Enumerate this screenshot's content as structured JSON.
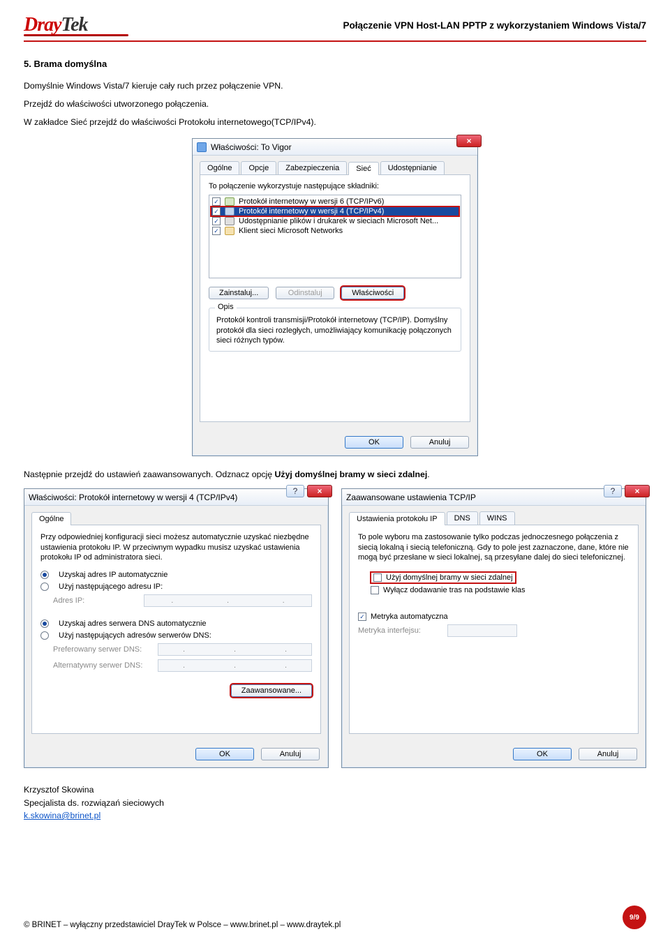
{
  "header": {
    "logo_main": "Dray",
    "logo_tail": "Tek",
    "doc_title": "Połączenie VPN Host-LAN PPTP z wykorzystaniem Windows Vista/7"
  },
  "section": {
    "heading": "5. Brama domyślna",
    "p1": "Domyślnie Windows Vista/7 kieruje cały ruch przez połączenie VPN.",
    "p2": "Przejdź do właściwości utworzonego połączenia.",
    "p3": "W zakładce Sieć przejdź do właściwości Protokołu internetowego(TCP/IPv4).",
    "p4_a": "Następnie przejdź do ustawień zaawansowanych. Odznacz opcję ",
    "p4_b": "Użyj domyślnej bramy w sieci zdalnej",
    "p4_c": "."
  },
  "dialog1": {
    "title": "Właściwości: To Vigor",
    "tabs": [
      "Ogólne",
      "Opcje",
      "Zabezpieczenia",
      "Sieć",
      "Udostępnianie"
    ],
    "active_tab": 3,
    "list_caption": "To połączenie wykorzystuje następujące składniki:",
    "items": [
      "Protokół internetowy w wersji 6 (TCP/IPv6)",
      "Protokół internetowy w wersji 4 (TCP/IPv4)",
      "Udostępnianie plików i drukarek w sieciach Microsoft Net...",
      "Klient sieci Microsoft Networks"
    ],
    "btn_install": "Zainstaluj...",
    "btn_uninstall": "Odinstaluj",
    "btn_props": "Właściwości",
    "desc_legend": "Opis",
    "desc_text": "Protokół kontroli transmisji/Protokół internetowy (TCP/IP). Domyślny protokół dla sieci rozległych, umożliwiający komunikację połączonych sieci różnych typów.",
    "ok": "OK",
    "cancel": "Anuluj"
  },
  "dialog2": {
    "title": "Właściwości: Protokół internetowy w wersji 4 (TCP/IPv4)",
    "tab": "Ogólne",
    "intro": "Przy odpowiedniej konfiguracji sieci możesz automatycznie uzyskać niezbędne ustawienia protokołu IP. W przeciwnym wypadku musisz uzyskać ustawienia protokołu IP od administratora sieci.",
    "r1": "Uzyskaj adres IP automatycznie",
    "r2": "Użyj następującego adresu IP:",
    "ip_label": "Adres IP:",
    "r3": "Uzyskaj adres serwera DNS automatycznie",
    "r4": "Użyj następujących adresów serwerów DNS:",
    "dns1": "Preferowany serwer DNS:",
    "dns2": "Alternatywny serwer DNS:",
    "advanced": "Zaawansowane...",
    "ok": "OK",
    "cancel": "Anuluj"
  },
  "dialog3": {
    "title": "Zaawansowane ustawienia TCP/IP",
    "tabs": [
      "Ustawienia protokołu IP",
      "DNS",
      "WINS"
    ],
    "intro": "To pole wyboru ma zastosowanie tylko podczas jednoczesnego połączenia z siecią lokalną i siecią telefoniczną. Gdy to pole jest zaznaczone, dane, które nie mogą być przesłane w sieci lokalnej, są przesyłane dalej do sieci telefonicznej.",
    "chk1": "Użyj domyślnej bramy w sieci zdalnej",
    "chk2": "Wyłącz dodawanie tras na podstawie klas",
    "chk3": "Metryka automatyczna",
    "metric_label": "Metryka interfejsu:",
    "ok": "OK",
    "cancel": "Anuluj"
  },
  "author": {
    "name": "Krzysztof Skowina",
    "role": "Specjalista ds. rozwiązań sieciowych",
    "email": "k.skowina@brinet.pl"
  },
  "footer": {
    "copyright": "© BRINET – wyłączny przedstawiciel DrayTek w Polsce – www.brinet.pl – www.draytek.pl",
    "page": "9/9"
  }
}
